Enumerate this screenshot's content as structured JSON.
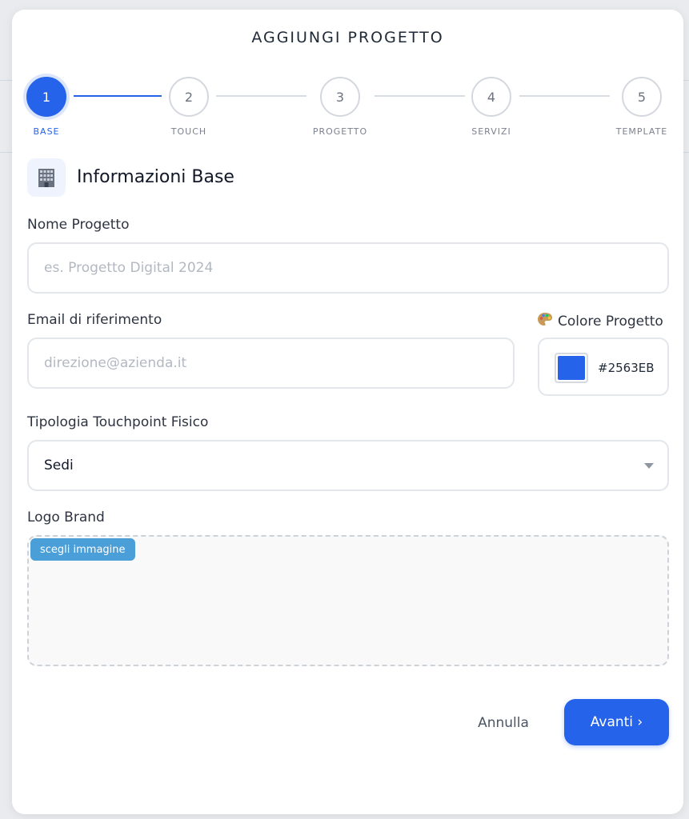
{
  "modal": {
    "title": "AGGIUNGI PROGETTO"
  },
  "stepper": {
    "steps": [
      {
        "number": "1",
        "label": "BASE",
        "active": true
      },
      {
        "number": "2",
        "label": "TOUCH",
        "active": false
      },
      {
        "number": "3",
        "label": "PROGETTO",
        "active": false
      },
      {
        "number": "4",
        "label": "SERVIZI",
        "active": false
      },
      {
        "number": "5",
        "label": "TEMPLATE",
        "active": false
      }
    ]
  },
  "section": {
    "icon": "office-building-icon",
    "title": "Informazioni Base"
  },
  "form": {
    "project_name": {
      "label": "Nome Progetto",
      "value": "",
      "placeholder": "es. Progetto Digital 2024"
    },
    "email": {
      "label": "Email di riferimento",
      "value": "",
      "placeholder": "direzione@azienda.it"
    },
    "color": {
      "label_icon": "palette-icon",
      "label": "Colore Progetto",
      "value": "#2563EB"
    },
    "touchpoint_type": {
      "label": "Tipologia Touchpoint Fisico",
      "selected": "Sedi"
    },
    "logo": {
      "label": "Logo Brand",
      "choose_label": "scegli immagine"
    }
  },
  "actions": {
    "cancel_label": "Annulla",
    "next_label": "Avanti ›"
  },
  "colors": {
    "accent": "#2563eb",
    "choose_button": "#4a9fd8"
  }
}
